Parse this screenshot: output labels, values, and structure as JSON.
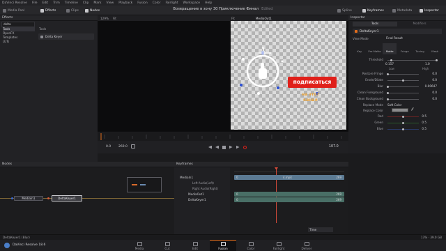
{
  "menu": [
    "DaVinci Resolve",
    "File",
    "Edit",
    "Trim",
    "Timeline",
    "Clip",
    "Mark",
    "View",
    "Playback",
    "Fusion",
    "Color",
    "Fairlight",
    "Workspace",
    "Help"
  ],
  "toolbar": {
    "media_pool": "Media Pool",
    "effects": "Effects",
    "clips": "Clips",
    "nodes": "Nodes",
    "spline": "Spline",
    "keyframes": "Keyframes",
    "metadata": "Metadata",
    "inspector": "Inspector"
  },
  "project_title": "Возвращение в зону 30 Приключение Финал",
  "edited": "Edited",
  "effects": {
    "header": "Effects",
    "search_value": "delta",
    "tree": [
      "Tools",
      "OpenFX",
      "Templates",
      "LUTs"
    ],
    "tools_header": "Tools",
    "result_item": "Delta Keyer"
  },
  "left_viewer": {
    "zoom": "129%",
    "fit": "Fit"
  },
  "right_viewer": {
    "zoom": "Fit",
    "name": "MediaOut1"
  },
  "overlay": {
    "cta": "подписаться",
    "sub1": "на этот",
    "sub2": "канал",
    "badge": "1"
  },
  "transport": {
    "start": "0.0",
    "end": "269.0",
    "current": "107.0"
  },
  "nodes": {
    "header": "Nodes",
    "node1": "MediaIn1",
    "node2": "DeltaKeyer1"
  },
  "keyframes": {
    "header": "Keyframes",
    "tracks": [
      "MediaIn1",
      "Left Audio(Left)",
      "Right Audio(Right)",
      "MediaOut1",
      "DeltaKeyer1"
    ],
    "clip_label": "0",
    "clip_name": "4.mp4",
    "clip_end": "269",
    "time_mode": "Time"
  },
  "inspector": {
    "header": "Inspector",
    "tab_tools": "Tools",
    "tab_modifiers": "Modifiers",
    "node_name": "DeltaKeyer1",
    "view_mode_label": "View Mode",
    "view_mode_value": "Final Result",
    "subtabs": [
      "Key",
      "Pre Matte",
      "Matte",
      "Fringe",
      "Tuning",
      "Mask"
    ],
    "threshold_label": "Threshold",
    "threshold_low": "0.157",
    "threshold_high": "1.0",
    "low": "Low",
    "high": "High",
    "rows": [
      {
        "label": "Restore Fringe",
        "value": "0.0"
      },
      {
        "label": "Erode/Dilate",
        "value": "0.0"
      },
      {
        "label": "Blur",
        "value": "0.00647"
      },
      {
        "label": "Clean Foreground",
        "value": "0.0"
      },
      {
        "label": "Clean Background",
        "value": "0.0"
      }
    ],
    "replace_mode_label": "Replace Mode",
    "replace_mode_value": "Soft Color",
    "replace_color_label": "Replace Color",
    "red_label": "Red",
    "red_value": "0.5",
    "green_label": "Green",
    "green_value": "0.5",
    "blue_label": "Blue",
    "blue_value": "0.5"
  },
  "status": {
    "left": "DeltaKeyer1 (Blur)",
    "right": "13% · 39.0 GB"
  },
  "footer": {
    "app": "DaVinci Resolve 18.6",
    "pages": [
      "Media",
      "Cut",
      "Edit",
      "Fusion",
      "Color",
      "Fairlight",
      "Deliver"
    ],
    "active_page": "Fusion"
  },
  "colors": {
    "accent": "#e26d1c",
    "cta_red": "#e0201a",
    "node_keyer": "#3c3c41",
    "clip_blue": "#5b7a93",
    "clip_green": "#496f66"
  }
}
